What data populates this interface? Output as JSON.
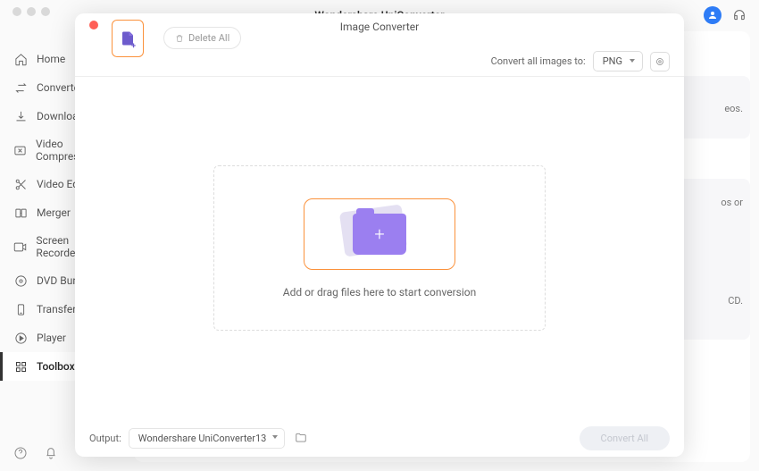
{
  "app": {
    "title": "Wondershare UniConverter"
  },
  "sidebar": {
    "items": [
      {
        "label": "Home"
      },
      {
        "label": "Converter"
      },
      {
        "label": "Downloader"
      },
      {
        "label": "Video Compressor"
      },
      {
        "label": "Video Editor"
      },
      {
        "label": "Merger"
      },
      {
        "label": "Screen Recorder"
      },
      {
        "label": "DVD Burner"
      },
      {
        "label": "Transfer"
      },
      {
        "label": "Player"
      },
      {
        "label": "Toolbox"
      }
    ]
  },
  "background_hints": {
    "hint1": "eos.",
    "hint2": "os or",
    "hint3": "CD."
  },
  "modal": {
    "title": "Image Converter",
    "delete_all": "Delete All",
    "convert_label": "Convert all images to:",
    "format": "PNG",
    "drop_text": "Add or drag files here to start conversion",
    "output_label": "Output:",
    "output_path": "Wondershare UniConverter13",
    "convert_button": "Convert All"
  }
}
